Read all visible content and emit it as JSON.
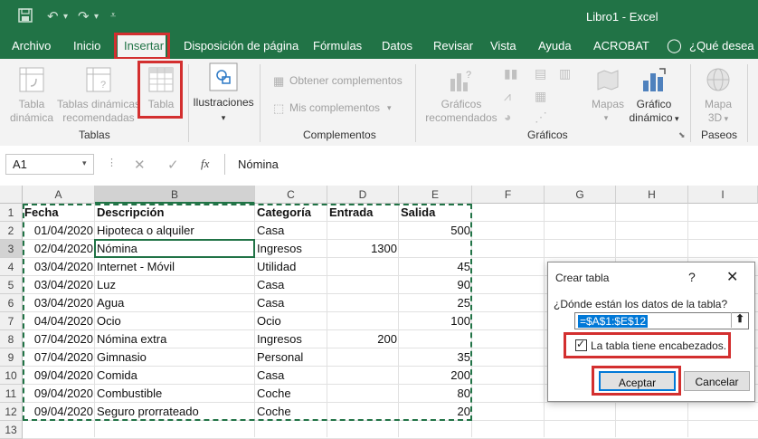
{
  "window": {
    "title": "Libro1  -  Excel"
  },
  "menu": {
    "tabs": [
      "Archivo",
      "Inicio",
      "Insertar",
      "Disposición de página",
      "Fórmulas",
      "Datos",
      "Revisar",
      "Vista",
      "Ayuda",
      "ACROBAT"
    ],
    "tell_me": "¿Qué desea ha"
  },
  "ribbon": {
    "tablas": {
      "tabla_dinamica": [
        "Tabla",
        "dinámica"
      ],
      "tablas_dinamicas_recomendadas": [
        "Tablas dinámicas",
        "recomendadas"
      ],
      "tabla": "Tabla",
      "group": "Tablas"
    },
    "ilustraciones": "Ilustraciones",
    "complementos": {
      "obtener": "Obtener complementos",
      "mis": "Mis complementos",
      "group": "Complementos"
    },
    "graficos": {
      "recomendados": [
        "Gráficos",
        "recomendados"
      ],
      "mapas": "Mapas",
      "dinamico": [
        "Gráfico",
        "dinámico"
      ],
      "group": "Gráficos"
    },
    "paseos": {
      "mapa3d": [
        "Mapa",
        "3D"
      ],
      "group": "Paseos"
    }
  },
  "formula_bar": {
    "name_box": "A1",
    "fx": "fx",
    "content": "Nómina"
  },
  "sheet": {
    "columns": [
      "A",
      "B",
      "C",
      "D",
      "E",
      "F",
      "G",
      "H",
      "I"
    ],
    "rows": [
      [
        "Fecha",
        "Descripción",
        "Categoría",
        "Entrada",
        "Salida"
      ],
      [
        "01/04/2020",
        "Hipoteca o alquiler",
        "Casa",
        "",
        "500"
      ],
      [
        "02/04/2020",
        "Nómina",
        "Ingresos",
        "1300",
        ""
      ],
      [
        "03/04/2020",
        "Internet - Móvil",
        "Utilidad",
        "",
        "45"
      ],
      [
        "03/04/2020",
        "Luz",
        "Casa",
        "",
        "90"
      ],
      [
        "03/04/2020",
        "Agua",
        "Casa",
        "",
        "25"
      ],
      [
        "04/04/2020",
        "Ocio",
        "Ocio",
        "",
        "100"
      ],
      [
        "07/04/2020",
        "Nómina extra",
        "Ingresos",
        "200",
        ""
      ],
      [
        "07/04/2020",
        "Gimnasio",
        "Personal",
        "",
        "35"
      ],
      [
        "09/04/2020",
        "Comida",
        "Casa",
        "",
        "200"
      ],
      [
        "09/04/2020",
        "Combustible",
        "Coche",
        "",
        "80"
      ],
      [
        "09/04/2020",
        "Seguro prorrateado",
        "Coche",
        "",
        "20"
      ]
    ]
  },
  "dialog": {
    "title": "Crear tabla",
    "help": "?",
    "question": "¿Dónde están los datos de la tabla?",
    "range": "=$A$1:$E$12",
    "checkbox_label": "La tabla tiene encabezados.",
    "checkbox_checked": true,
    "ok": "Aceptar",
    "cancel": "Cancelar"
  },
  "colors": {
    "brand": "#217346",
    "highlight": "#d32f2f",
    "selection_range": "#2f5597"
  }
}
